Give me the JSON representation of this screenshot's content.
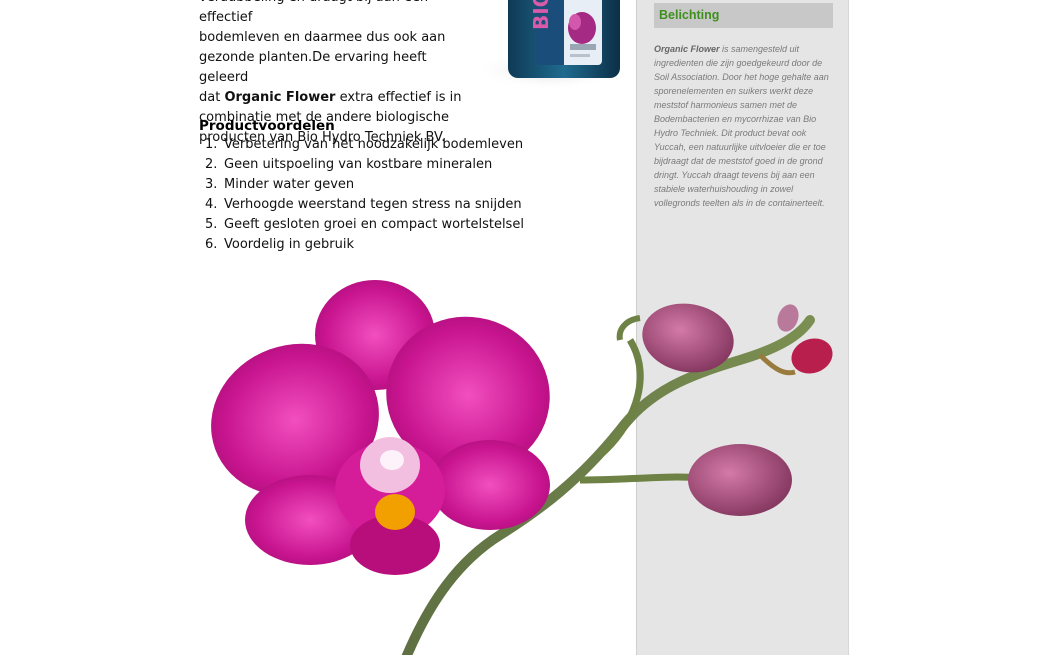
{
  "content": {
    "intro_line_1": "verdubbeling en draagt bij aan een effectief",
    "intro_line_2": "bodemleven en daarmee dus ook aan",
    "intro_line_3": "gezonde planten.De ervaring heeft geleerd",
    "intro_line_4a": "dat ",
    "intro_line_4_bold": "Organic Flower",
    "intro_line_4b": " extra effectief is in",
    "intro_line_5": "combinatie met de andere biologische",
    "intro_line_6": "producten van Bio Hydro Techniek BV.",
    "benefits_title": "Productvoordelen",
    "benefits": [
      {
        "num": "1.",
        "text": "Verbetering van het noodzakelijk bodemleven"
      },
      {
        "num": "2.",
        "text": "Geen uitspoeling van kostbare mineralen"
      },
      {
        "num": "3.",
        "text": "Minder water geven"
      },
      {
        "num": "4.",
        "text": "Verhoogde weerstand tegen stress na snijden"
      },
      {
        "num": "5.",
        "text": "Geeft gesloten groei en compact wortelstelsel"
      },
      {
        "num": "6.",
        "text": "Voordelig in gebruik"
      }
    ]
  },
  "sidebar": {
    "heading": "Belichting",
    "heading_color": "#3f8f1f",
    "text_bold": "Organic Flower",
    "text_rest": " is samengesteld uit ingredienten die zijn goedgekeurd door de Soil Association. Door het hoge gehalte aan sporenelementen en suikers werkt deze meststof harmonieus samen met de Bodembacterien en mycorrhizae van Bio Hydro Techniek. Dit product bevat ook Yuccah, een natuurlijke uitvloeier die er toe bijdraagt dat de meststof goed in de grond dringt. Yuccah draagt tevens bij aan een stabiele waterhuishouding in zowel vollegronds teelten als in de containerteelt."
  },
  "images": {
    "product_bottle": "product-bottle-image",
    "orchid": "orchid-flower-image"
  }
}
